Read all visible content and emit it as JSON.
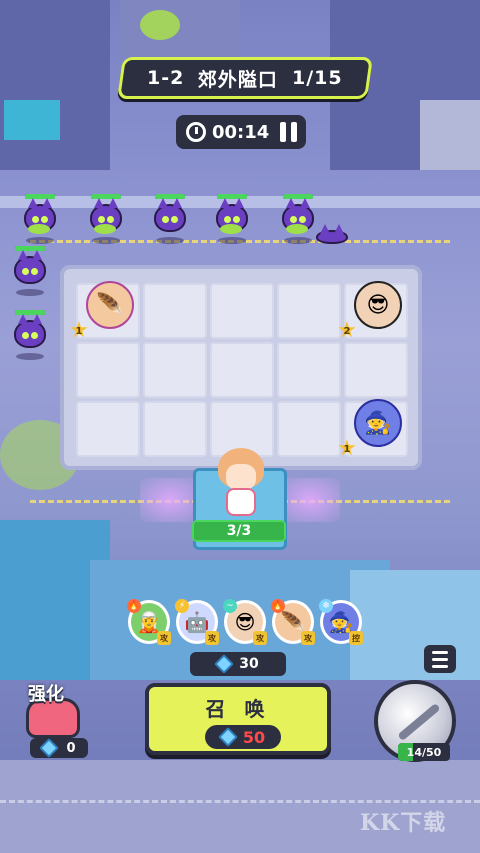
{
  "hud": {
    "stage": "1-2",
    "stage_name": "郊外隘口",
    "wave": "1/15",
    "timer": "00:14"
  },
  "board": {
    "heroes": [
      {
        "name": "feather-headdress-hero",
        "star": "1"
      },
      {
        "name": "black-hair-hero",
        "star": "2"
      },
      {
        "name": "blue-hair-hero",
        "star": "1"
      }
    ]
  },
  "player": {
    "hp": "3/3",
    "hp_fraction": 1.0
  },
  "hero_bar": [
    {
      "icon": "fire-element-icon",
      "role": "攻"
    },
    {
      "icon": "lightning-element-icon",
      "role": "攻"
    },
    {
      "icon": "wind-element-icon",
      "role": "攻"
    },
    {
      "icon": "fire-element-icon",
      "role": "攻"
    },
    {
      "icon": "ice-element-icon",
      "role": "控"
    }
  ],
  "gems": "30",
  "summon": {
    "label": "召 唤",
    "cost": "50"
  },
  "upgrade": {
    "label": "强化",
    "cost": "0"
  },
  "skill": {
    "energy": "14/50",
    "energy_fraction": 0.28
  },
  "watermark": "KK下载",
  "colors": {
    "accent": "#d7f24b",
    "panel": "#2c2f3f",
    "hp_green": "#37b54a",
    "cost_red": "#ff4a4a"
  }
}
